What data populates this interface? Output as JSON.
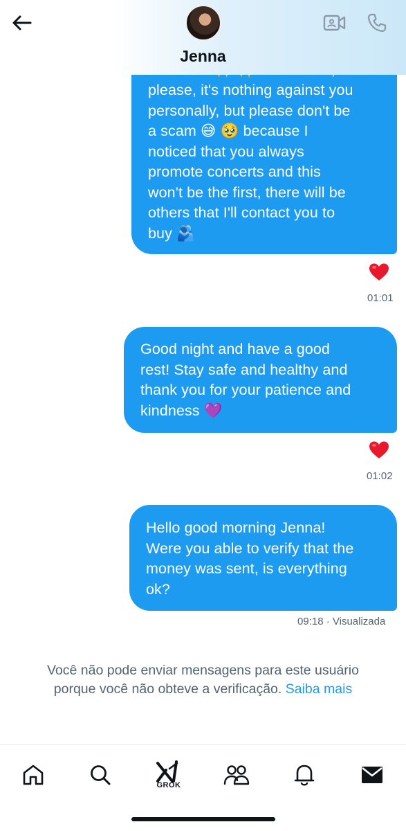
{
  "header": {
    "contact_name": "Jenna",
    "back_icon": "arrow-left-icon",
    "video_icon": "video-camera-icon",
    "call_icon": "phone-icon"
  },
  "messages": [
    {
      "cut_top_text": "tomorrow ✨ ✨ And Jenna,",
      "lines": [
        "please, it's nothing against you",
        "personally, but please don't be",
        "a scam 😅 🥹 because I",
        "noticed that you always",
        "promote concerts and this",
        "won't be the first, there will be",
        "others that I'll contact you to",
        "buy 🫂"
      ],
      "reaction": "❤️",
      "time": "01:01"
    },
    {
      "lines": [
        "Good night and have a good",
        "rest! Stay safe and healthy and",
        "thank you for your patience and",
        "kindness 💜"
      ],
      "reaction": "❤️",
      "time": "01:02"
    },
    {
      "lines": [
        "Hello good morning Jenna!",
        "Were you able to verify that the",
        "money was sent, is everything",
        "ok?"
      ],
      "time": "09:18",
      "status": " · Visualizada"
    }
  ],
  "notice": {
    "line1": "Você não pode enviar mensagens para este usuário",
    "line2": "porque você não obteve a verificação.",
    "link": "Saiba mais"
  },
  "tabbar": {
    "items": [
      "home-icon",
      "search-icon",
      "grok-icon",
      "communities-icon",
      "notifications-icon",
      "messages-icon"
    ],
    "grok_label": "GROK"
  },
  "colors": {
    "bubble": "#1d9bf0",
    "secondary_text": "#536471",
    "link": "#1d9bf0"
  }
}
